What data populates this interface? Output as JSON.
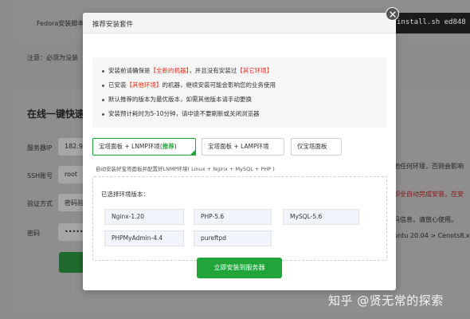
{
  "background": {
    "fedora_text": "Fedora安装脚本",
    "code_text": "install.sh ed848",
    "note_text": "注意：必须为没装",
    "section_title": "在线一键快速",
    "labels": [
      "服务器IP",
      "SSH账号",
      "验证方式",
      "密码"
    ],
    "ip_value": "182.92",
    "ssh_value": "root",
    "auth_value": "密码验",
    "password_value": "••••••••",
    "right_texts": [
      "他任何环境，否则会影响",
      "即全自动完成安装，在安",
      "码信息，请放心使用。",
      "untu 20.04 > Cenots8.x >"
    ],
    "watermark": "知乎 @贤无常的探索"
  },
  "modal": {
    "title": "推荐安装套件",
    "notices": [
      {
        "before": "安装前请确保是",
        "highlight": "【全新的机器】",
        "middle": "，并且没有安装过",
        "highlight2": "【其它环境】",
        "after": ""
      },
      {
        "before": "已安装",
        "highlight": "【其他环境】",
        "middle": "的机器，继续安装可能会影响您的业务使用",
        "highlight2": "",
        "after": ""
      },
      {
        "before": "默认推荐的版本为最优版本，如需其他版本请手动更换",
        "highlight": "",
        "middle": "",
        "highlight2": "",
        "after": ""
      },
      {
        "before": "安装预计耗时为5-10分钟，请中途不要刷新或关闭浏览器",
        "highlight": "",
        "middle": "",
        "highlight2": "",
        "after": ""
      }
    ],
    "tabs": {
      "lnmp_label": "宝塔面板 + LNMP环境(",
      "lnmp_recommend": "推荐",
      "lnmp_suffix": ")",
      "lamp_label": "宝塔面板 + LAMP环境",
      "only_label": "仅宝塔面板"
    },
    "hint": "自动安装好宝塔面板并配置好LNMP环境( Linux + Nginx + MySQL + PHP )",
    "env_title": "已选择环境版本：",
    "selects": {
      "nginx": "Nginx-1.20",
      "php": "PHP-5.6",
      "mysql": "MySQL-5.6",
      "phpmyadmin": "PHPMyAdmin-4.4",
      "ftp": "pureftpd"
    },
    "install_button": "立即安装到服务器"
  },
  "colors": {
    "accent_green": "#20a53a",
    "highlight_red": "#e0301e"
  }
}
